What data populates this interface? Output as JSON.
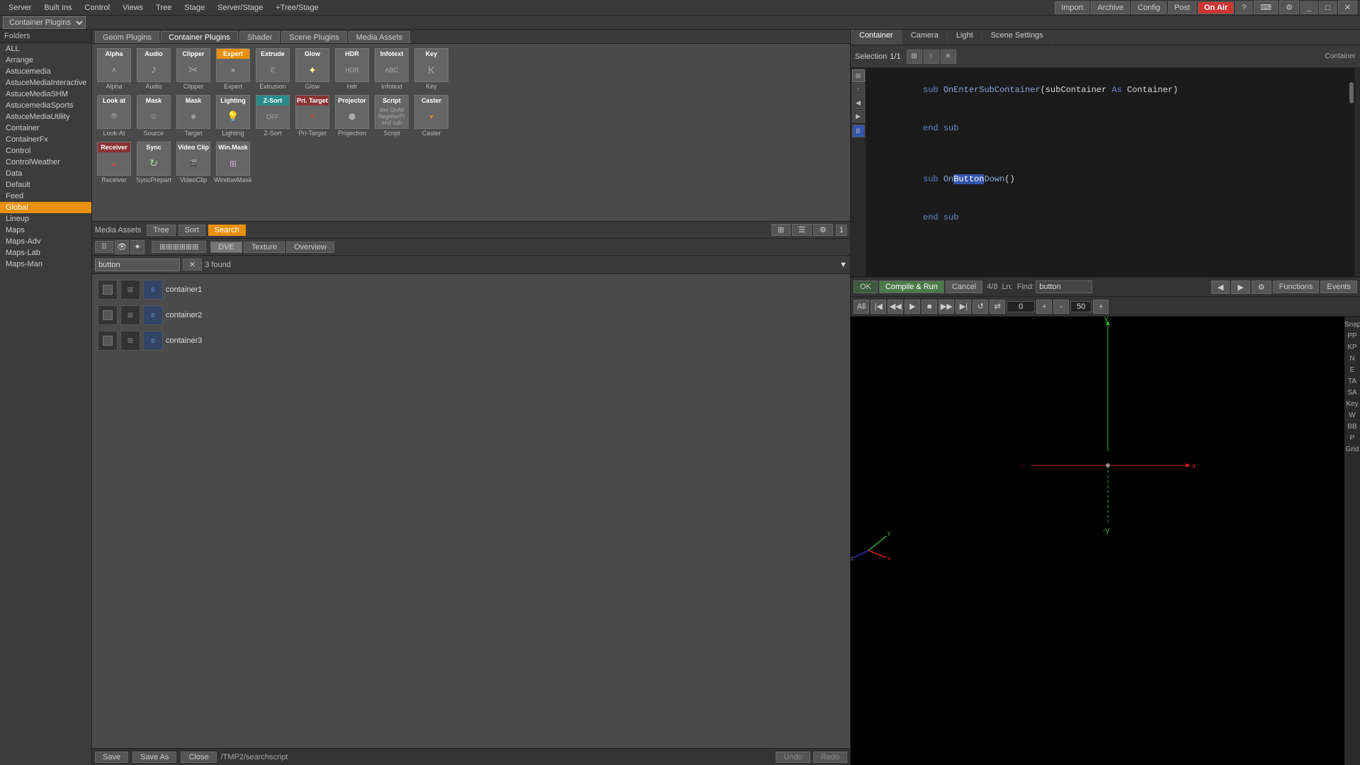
{
  "topbar": {
    "server": "Server",
    "built_ins": "Built Ins",
    "control": "Control",
    "views": "Views",
    "tree": "Tree",
    "stage": "Stage",
    "server_stage": "Server/Stage",
    "tree_stage": "+Tree/Stage",
    "import": "Import",
    "archive": "Archive",
    "config": "Config",
    "post": "Post",
    "on_air": "On Air",
    "help_icon": "?",
    "container_plugins": "Container Plugins"
  },
  "plugin_tabs": [
    "Geom Plugins",
    "Container Plugins",
    "Shader",
    "Scene Plugins",
    "Media Assets"
  ],
  "plugin_rows": {
    "row1": [
      {
        "label": "Alpha",
        "labelColor": "gray",
        "name": "Alpha"
      },
      {
        "label": "Audio",
        "labelColor": "gray",
        "name": "Audio"
      },
      {
        "label": "Clipper",
        "labelColor": "gray",
        "name": "Clipper"
      },
      {
        "label": "Expert",
        "labelColor": "orange",
        "name": "Expert"
      },
      {
        "label": "Extrude",
        "labelColor": "gray",
        "name": "Extrusion"
      },
      {
        "label": "Glow",
        "labelColor": "gray",
        "name": "Glow"
      },
      {
        "label": "HDR",
        "labelColor": "gray",
        "name": "Hdr"
      },
      {
        "label": "Infotext",
        "labelColor": "gray",
        "name": "Infotext"
      },
      {
        "label": "Key",
        "labelColor": "gray",
        "name": "Key"
      }
    ],
    "row2": [
      {
        "label": "Look at",
        "labelColor": "gray",
        "name": "Look-At"
      },
      {
        "label": "Mask",
        "labelColor": "gray",
        "name": "Source"
      },
      {
        "label": "Mask",
        "labelColor": "gray",
        "name": "Target"
      },
      {
        "label": "Lighting",
        "labelColor": "gray",
        "name": "Lighting"
      },
      {
        "label": "Z-Sort",
        "labelColor": "teal",
        "name": "Z-Sort"
      },
      {
        "label": "Pri. Target",
        "labelColor": "red",
        "name": "Pri-Target"
      },
      {
        "label": "Projector",
        "labelColor": "gray",
        "name": "Projection"
      },
      {
        "label": "Script",
        "labelColor": "gray",
        "name": "Script"
      },
      {
        "label": "Caster",
        "labelColor": "gray",
        "name": "Caster"
      }
    ],
    "row3": [
      {
        "label": "Receiver",
        "labelColor": "red",
        "name": "Receiver"
      },
      {
        "label": "Sync",
        "labelColor": "gray",
        "name": "SyncPrepart"
      },
      {
        "label": "Video Clip",
        "labelColor": "gray",
        "name": "VideoClip"
      },
      {
        "label": "Win.Mask",
        "labelColor": "gray",
        "name": "WindowMask"
      }
    ]
  },
  "sidebar": {
    "header": "Folders",
    "items": [
      "ALL",
      "Arrange",
      "Astucemedia",
      "AstuceMediaInteractive",
      "AstuceMediaSHM",
      "AstucemediaSports",
      "AstuceMediaUtility",
      "Container",
      "ContainerFx",
      "Control",
      "ControlWeather",
      "Data",
      "Default",
      "Feed",
      "Global",
      "Lineup",
      "Maps",
      "Maps-Adv",
      "Maps-Lab",
      "Maps-Man"
    ],
    "selected": "Global"
  },
  "media_assets": {
    "label": "Media Assets",
    "toolbar_buttons": [
      "Tree",
      "Sort",
      "Search"
    ],
    "view_tabs": [
      "DVE",
      "Texture",
      "Overview"
    ],
    "active_view": "DVE",
    "search_placeholder": "button",
    "found_count": "3 found",
    "results": [
      {
        "name": "container1"
      },
      {
        "name": "container2"
      },
      {
        "name": "container3"
      }
    ]
  },
  "path_bar": {
    "save": "Save",
    "save_as": "Save As",
    "close": "Close",
    "path": "/TMP2/searchscript",
    "undo": "Undo",
    "redo": "Redo"
  },
  "right_panel": {
    "tabs": [
      "Container",
      "Camera",
      "Light",
      "Scene Settings"
    ],
    "active_tab": "Container",
    "selection_label": "Selection",
    "selection_value": "1/1",
    "container_label": "Container",
    "script_lines": [
      "sub OnEnterSubContainer(subContainer As Container)",
      "end sub",
      "",
      "sub OnButtonDown()",
      "end sub"
    ],
    "editor": {
      "compile_run": "Compile & Run",
      "cancel": "Cancel",
      "match_info": "4/8",
      "ln_label": "Ln:",
      "find_label": "Find:",
      "find_value": "button",
      "functions": "Functions",
      "events": "Events"
    },
    "playback": {
      "all_label": "All",
      "frame_value": "0",
      "time_value": "50"
    },
    "viewport_side": [
      "Snap",
      "PP",
      "KP",
      "N",
      "E",
      "TA",
      "SA",
      "Key",
      "W",
      "BB",
      "P",
      "Grid"
    ],
    "axis": {
      "y_label": "y",
      "y_neg_label": "-y",
      "x_label": "x",
      "x_neg": "-"
    }
  }
}
